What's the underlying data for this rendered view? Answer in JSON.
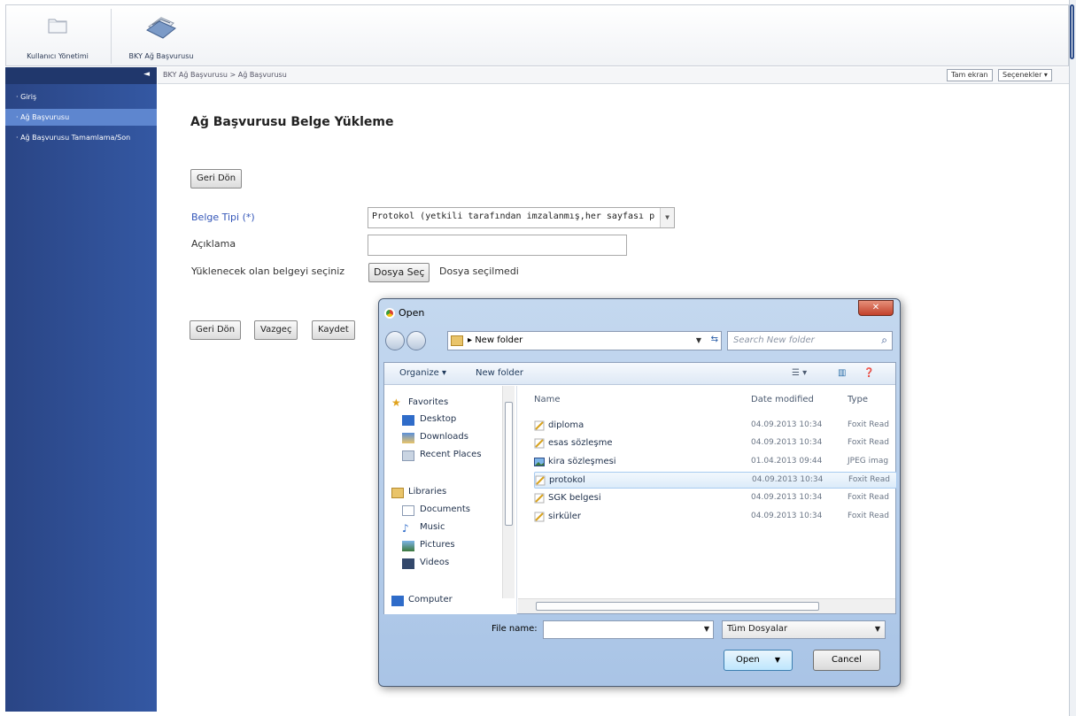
{
  "ribbon": {
    "user_mgmt_label": "Kullanıcı Yönetimi",
    "bky_label": "BKY Ağ Başvurusu"
  },
  "nav": {
    "collapse_icon": "◄",
    "items": [
      {
        "label": "· Giriş"
      },
      {
        "label": "· Ağ Başvurusu"
      },
      {
        "label": "· Ağ Başvurusu Tamamlama/Son"
      }
    ]
  },
  "breadcrumb": {
    "text": "BKY Ağ Başvurusu  >  Ağ Başvurusu",
    "fullscreen": "Tam ekran",
    "options": "Seçenekler ▾"
  },
  "form": {
    "title": "Ağ Başvurusu Belge Yükleme",
    "back_top": "Geri Dön",
    "doc_type_label": "Belge Tipi (*)",
    "doc_type_value": "Protokol (yetkili tarafından imzalanmış,her sayfası p",
    "desc_label": "Açıklama",
    "desc_value": "",
    "file_label": "Yüklenecek olan belgeyi seçiniz",
    "file_button": "Dosya Seç",
    "file_status": "Dosya seçilmedi",
    "back_bottom": "Geri Dön",
    "cancel": "Vazgeç",
    "save": "Kaydet"
  },
  "dialog": {
    "title": "Open",
    "close": "✕",
    "path": "▸ New folder",
    "search_placeholder": "Search New folder",
    "organize": "Organize ▾",
    "new_folder": "New folder",
    "nav_items": {
      "favorites": "Favorites",
      "desktop": "Desktop",
      "downloads": "Downloads",
      "recent": "Recent Places",
      "libraries": "Libraries",
      "documents": "Documents",
      "music": "Music",
      "pictures": "Pictures",
      "videos": "Videos",
      "computer": "Computer"
    },
    "columns": {
      "name": "Name",
      "date": "Date modified",
      "type": "Type"
    },
    "files": [
      {
        "name": "diploma",
        "date": "04.09.2013 10:34",
        "type": "Foxit Read",
        "icon": "pdf-icon"
      },
      {
        "name": "esas sözleşme",
        "date": "04.09.2013 10:34",
        "type": "Foxit Read",
        "icon": "pdf-icon"
      },
      {
        "name": "kira sözleşmesi",
        "date": "01.04.2013 09:44",
        "type": "JPEG imag",
        "icon": "image-icon"
      },
      {
        "name": "protokol",
        "date": "04.09.2013 10:34",
        "type": "Foxit Read",
        "icon": "pdf-icon"
      },
      {
        "name": "SGK belgesi",
        "date": "04.09.2013 10:34",
        "type": "Foxit Read",
        "icon": "pdf-icon"
      },
      {
        "name": "sirküler",
        "date": "04.09.2013 10:34",
        "type": "Foxit Read",
        "icon": "pdf-icon"
      }
    ],
    "filename_label": "File name:",
    "filename_value": "",
    "filter_value": "Tüm Dosyalar",
    "open": "Open",
    "cancel": "Cancel"
  }
}
